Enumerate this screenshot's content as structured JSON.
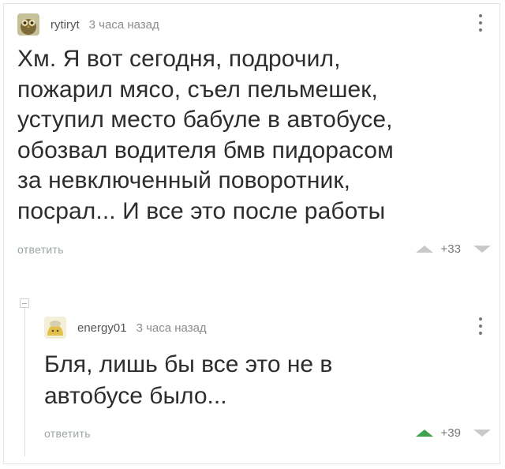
{
  "comments": [
    {
      "username": "rytiryt",
      "time": "3 часа назад",
      "text": "Хм. Я вот сегодня, подрочил,\nпожарил мясо, съел пельмешек,\nуступил место бабуле в автобусе,\nобозвал водителя бмв пидорасом\nза невключенный поворотник,\nпосрал... И все это после работы",
      "reply_label": "ответить",
      "score": "+33",
      "upvoted": false
    },
    {
      "username": "energy01",
      "time": "3 часа назад",
      "text": "Бля, лишь бы все это не в\nавтобусе было...",
      "reply_label": "ответить",
      "score": "+39",
      "upvoted": true
    }
  ],
  "colors": {
    "upvote_active": "#3fa34d",
    "vote_inactive": "#c9c9c9",
    "reply_link": "#9aa7a0"
  },
  "icons": {
    "avatar1": "owl-avatar",
    "avatar2": "yellow-avatar",
    "more": "more-vertical-icon",
    "upvote": "triangle-up-icon",
    "downvote": "triangle-down-icon",
    "collapse": "collapse-minus-icon"
  }
}
